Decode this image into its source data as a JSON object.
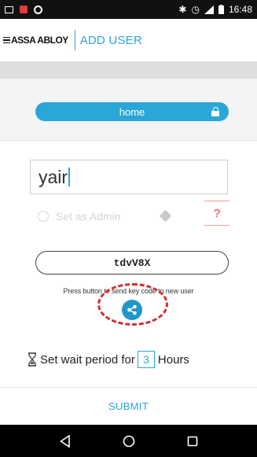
{
  "status_bar": {
    "time": "16:48",
    "icons": [
      "gallery-icon",
      "notification-icon",
      "sync-icon",
      "bluetooth-icon",
      "alarm-icon",
      "signal-icon",
      "battery-icon"
    ]
  },
  "header": {
    "brand": "ASSA ABLOY",
    "title": "ADD USER",
    "accent_color": "#2aa7d6"
  },
  "lock": {
    "name": "home",
    "icon": "lock-icon"
  },
  "form": {
    "user_name_value": "yair",
    "admin_label": "Set as Admin",
    "help_label": "?",
    "key_code": "tdvV8X",
    "instruction": "Press button to send key code to new user",
    "share_icon": "share-icon",
    "wait_prefix": "Set wait period for",
    "wait_value": "3",
    "wait_unit": "Hours"
  },
  "submit": {
    "label": "SUBMIT"
  },
  "nav": {
    "back": "back-icon",
    "home": "home-icon",
    "recents": "recents-icon"
  },
  "colors": {
    "highlight": "#d32f2f",
    "share": "#2196c9",
    "help": "#e53935"
  }
}
